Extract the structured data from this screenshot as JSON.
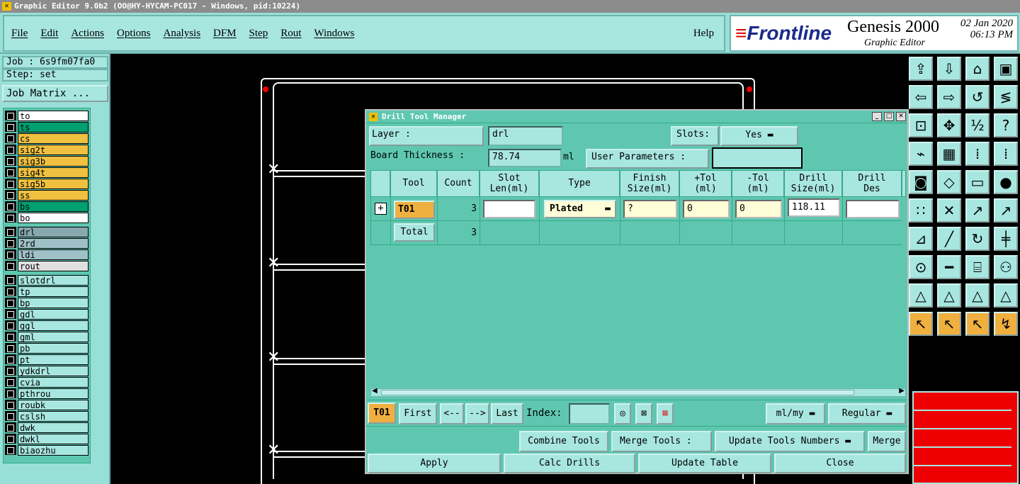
{
  "window": {
    "title": "Graphic Editor 9.0b2 (OO@HY-HYCAM-PC017 - Windows, pid:10224)"
  },
  "menu": {
    "items": [
      "File",
      "Edit",
      "Actions",
      "Options",
      "Analysis",
      "DFM",
      "Step",
      "Rout",
      "Windows"
    ],
    "help": "Help"
  },
  "brand": {
    "logo": "Frontline",
    "product": "Genesis 2000",
    "subtitle": "Graphic Editor",
    "date": "02 Jan 2020",
    "time": "06:13 PM"
  },
  "job": {
    "job_label": "Job  : 6s9fm07fa0",
    "step_label": "Step: set",
    "matrix_button": "Job Matrix ..."
  },
  "layers": [
    {
      "name": "to",
      "color": "#ffffff"
    },
    {
      "name": "ts",
      "color": "#00a070"
    },
    {
      "name": "cs",
      "color": "#f0c040"
    },
    {
      "name": "sig2t",
      "color": "#f0c040"
    },
    {
      "name": "sig3b",
      "color": "#f0c040"
    },
    {
      "name": "sig4t",
      "color": "#f0c040"
    },
    {
      "name": "sig5b",
      "color": "#f0c040"
    },
    {
      "name": "ss",
      "color": "#f0c040"
    },
    {
      "name": "bs",
      "color": "#00a070"
    },
    {
      "name": "bo",
      "color": "#ffffff"
    },
    {
      "name": "drl",
      "color": "#88a8b0"
    },
    {
      "name": "2rd",
      "color": "#a0c0c8"
    },
    {
      "name": "ldi",
      "color": "#a0c0c8"
    },
    {
      "name": "rout",
      "color": "#e0e0e0"
    },
    {
      "name": "slotdrl",
      "color": "#a8e6e0"
    },
    {
      "name": "tp",
      "color": "#a8e6e0"
    },
    {
      "name": "bp",
      "color": "#a8e6e0"
    },
    {
      "name": "gdl",
      "color": "#a8e6e0"
    },
    {
      "name": "ggl",
      "color": "#a8e6e0"
    },
    {
      "name": "gml",
      "color": "#a8e6e0"
    },
    {
      "name": "pb",
      "color": "#a8e6e0"
    },
    {
      "name": "pt",
      "color": "#a8e6e0"
    },
    {
      "name": "ydkdrl",
      "color": "#a8e6e0"
    },
    {
      "name": "cvia",
      "color": "#a8e6e0"
    },
    {
      "name": "pthrou",
      "color": "#a8e6e0"
    },
    {
      "name": "roubk",
      "color": "#a8e6e0"
    },
    {
      "name": "cslsh",
      "color": "#a8e6e0"
    },
    {
      "name": "dwk",
      "color": "#a8e6e0"
    },
    {
      "name": "dwkl",
      "color": "#a8e6e0"
    },
    {
      "name": "biaozhu",
      "color": "#a8e6e0"
    }
  ],
  "dialog": {
    "title": "Drill Tool Manager",
    "layer_label": "Layer          :",
    "layer_value": "drl",
    "slots_label": "Slots:",
    "slots_value": "Yes",
    "thickness_label": "Board Thickness :",
    "thickness_value": "78.74",
    "thickness_unit": "ml",
    "user_params_label": "User Parameters :",
    "columns": [
      "Tool",
      "Count",
      "Slot\nLen(ml)",
      "Type",
      "Finish\nSize(ml)",
      "+Tol\n(ml)",
      "-Tol\n(ml)",
      "Drill\nSize(ml)",
      "Drill\nDes"
    ],
    "row": {
      "tool": "T01",
      "count": "3",
      "slot_len": "",
      "type": "Plated",
      "finish": "?",
      "plus_tol": "0",
      "minus_tol": "0",
      "drill_size": "118.11",
      "drill_des": ""
    },
    "total": {
      "label": "Total",
      "count": "3"
    },
    "nav": {
      "current": "T01",
      "first": "First",
      "prev": "<--",
      "next": "-->",
      "last": "Last",
      "index_label": "Index:",
      "units": "ml/my",
      "mode": "Regular"
    },
    "actions": {
      "combine": "Combine Tools",
      "merge_label": "Merge Tools :",
      "merge_option": "Update Tools Numbers",
      "merge": "Merge"
    },
    "footer": {
      "apply": "Apply",
      "calc": "Calc Drills",
      "update": "Update Table",
      "close": "Close"
    }
  }
}
